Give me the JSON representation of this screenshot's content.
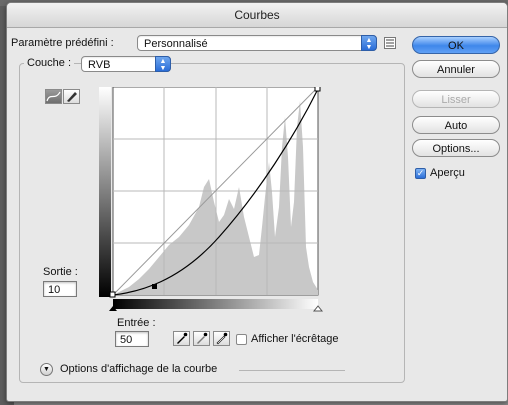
{
  "window": {
    "title": "Courbes"
  },
  "preset": {
    "label": "Paramètre prédéfini :",
    "value": "Personnalisé"
  },
  "channel": {
    "label": "Couche :",
    "value": "RVB"
  },
  "output": {
    "label": "Sortie :",
    "value": "10"
  },
  "input": {
    "label": "Entrée :",
    "value": "50"
  },
  "clipping": {
    "label": "Afficher l'écrêtage",
    "checked": false
  },
  "buttons": {
    "ok": "OK",
    "cancel": "Annuler",
    "smooth": "Lisser",
    "auto": "Auto",
    "options": "Options..."
  },
  "preview": {
    "label": "Aperçu",
    "checked": true
  },
  "display_options": {
    "label": "Options d'affichage de la courbe"
  },
  "icons": {
    "curve_tool": "curve-point-icon",
    "pencil_tool": "pencil-icon",
    "black_eyedropper": "eyedropper-black-icon",
    "gray_eyedropper": "eyedropper-gray-icon",
    "white_eyedropper": "eyedropper-white-icon",
    "preset_menu": "preset-menu-icon"
  },
  "colors": {
    "accent": "#3f87ea",
    "histogram": "#c8c8c8",
    "curve": "#000000"
  },
  "curve": {
    "points": [
      [
        0,
        0
      ],
      [
        50,
        10
      ],
      [
        255,
        255
      ]
    ]
  }
}
